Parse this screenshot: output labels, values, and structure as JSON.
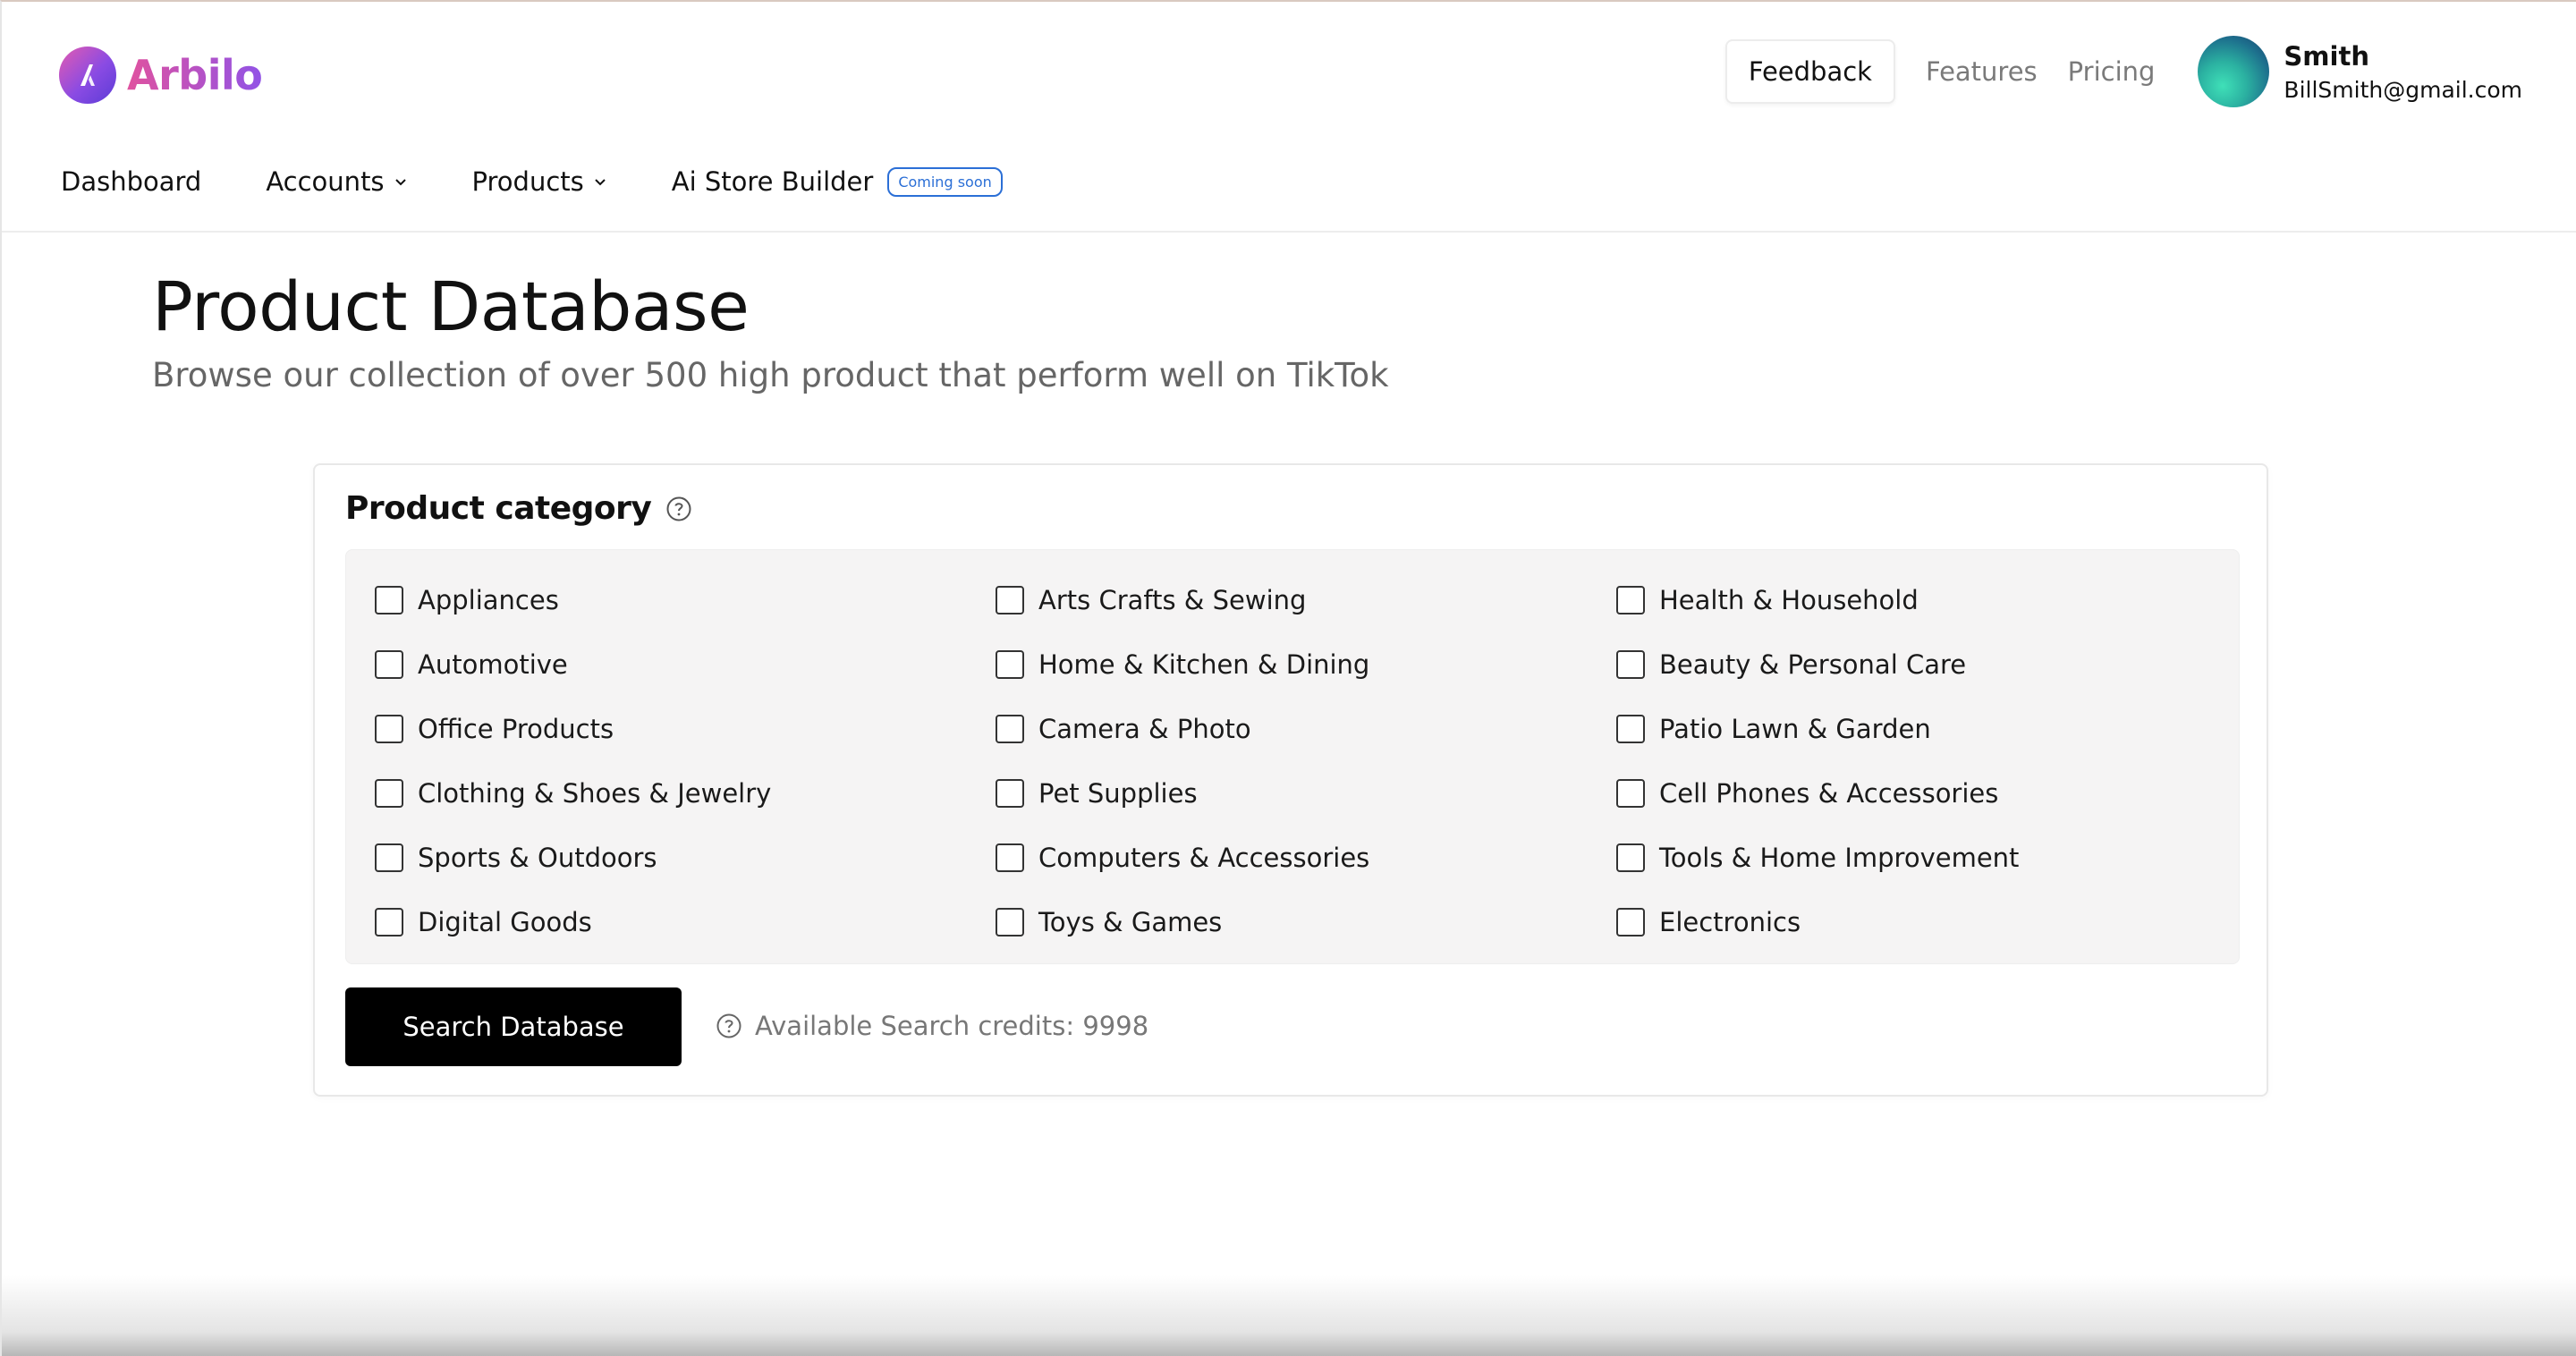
{
  "app": {
    "logo_text": "Arbilo"
  },
  "header": {
    "feedback_label": "Feedback",
    "features_label": "Features",
    "pricing_label": "Pricing",
    "user_name": "Smith",
    "user_email": "BillSmith@gmail.com"
  },
  "nav": {
    "items": [
      {
        "label": "Dashboard"
      },
      {
        "label": "Accounts"
      },
      {
        "label": "Products"
      },
      {
        "label": "Ai Store Builder",
        "badge": "Coming soon"
      }
    ]
  },
  "page": {
    "title": "Product Database",
    "subtitle": "Browse our collection of over 500 high product that perform well on TikTok"
  },
  "category": {
    "title": "Product category",
    "columns": [
      [
        "Appliances",
        "Automotive",
        "Office Products",
        "Clothing & Shoes & Jewelry",
        "Sports & Outdoors",
        "Digital Goods"
      ],
      [
        "Arts Crafts & Sewing",
        "Home & Kitchen & Dining",
        "Camera & Photo",
        "Pet Supplies",
        "Computers & Accessories",
        "Toys & Games"
      ],
      [
        "Health & Household",
        "Beauty & Personal Care",
        "Patio Lawn & Garden",
        "Cell Phones & Accessories",
        "Tools & Home Improvement",
        "Electronics"
      ]
    ]
  },
  "actions": {
    "search_label": "Search Database",
    "credits_text": "Available Search credits: 9998"
  },
  "colors": {
    "accent_blue": "#2b6fd6",
    "logo_pink": "#e0529f",
    "logo_purple": "#9153e6",
    "button_black": "#000000"
  }
}
